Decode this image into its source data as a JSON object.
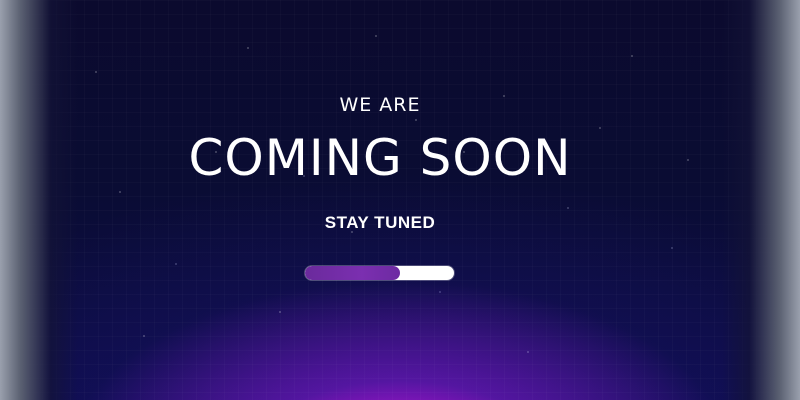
{
  "page": {
    "eyebrow": "WE ARE",
    "headline": "COMING SOON",
    "tagline": "STAY TUNED"
  },
  "progress": {
    "value": 0.64
  },
  "colors": {
    "background": "#0b0a2e",
    "glow": "#ff28ff",
    "progress_fill": "#7b2fb0",
    "progress_track": "#ffffff",
    "text": "#ffffff"
  }
}
